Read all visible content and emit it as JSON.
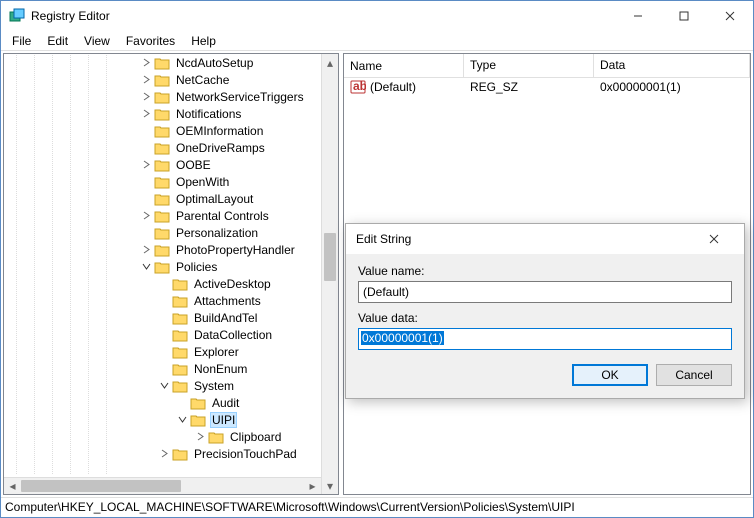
{
  "window": {
    "title": "Registry Editor"
  },
  "menubar": [
    "File",
    "Edit",
    "View",
    "Favorites",
    "Help"
  ],
  "tree": {
    "expandedPolicies": "Policies",
    "items_top": [
      {
        "label": "NcdAutoSetup",
        "expander": "r"
      },
      {
        "label": "NetCache",
        "expander": "r"
      },
      {
        "label": "NetworkServiceTriggers",
        "expander": "r"
      },
      {
        "label": "Notifications",
        "expander": "r"
      },
      {
        "label": "OEMInformation",
        "expander": ""
      },
      {
        "label": "OneDriveRamps",
        "expander": ""
      },
      {
        "label": "OOBE",
        "expander": "r"
      },
      {
        "label": "OpenWith",
        "expander": ""
      },
      {
        "label": "OptimalLayout",
        "expander": ""
      },
      {
        "label": "Parental Controls",
        "expander": "r"
      },
      {
        "label": "Personalization",
        "expander": ""
      },
      {
        "label": "PhotoPropertyHandler",
        "expander": "r"
      }
    ],
    "policy_children": [
      "ActiveDesktop",
      "Attachments",
      "BuildAndTel",
      "DataCollection",
      "Explorer",
      "NonEnum"
    ],
    "system_label": "System",
    "system_children": [
      "Audit"
    ],
    "uipi": "UIPI",
    "uipi_child": "Clipboard",
    "tail": "PrecisionTouchPad"
  },
  "list": {
    "headers": {
      "name": "Name",
      "type": "Type",
      "data": "Data"
    },
    "row": {
      "name": "(Default)",
      "type": "REG_SZ",
      "data": "0x00000001(1)"
    }
  },
  "dialog": {
    "title": "Edit String",
    "valueNameLabel": "Value name:",
    "valueName": "(Default)",
    "valueDataLabel": "Value data:",
    "valueData": "0x00000001(1)",
    "ok": "OK",
    "cancel": "Cancel"
  },
  "statusbar": "Computer\\HKEY_LOCAL_MACHINE\\SOFTWARE\\Microsoft\\Windows\\CurrentVersion\\Policies\\System\\UIPI"
}
